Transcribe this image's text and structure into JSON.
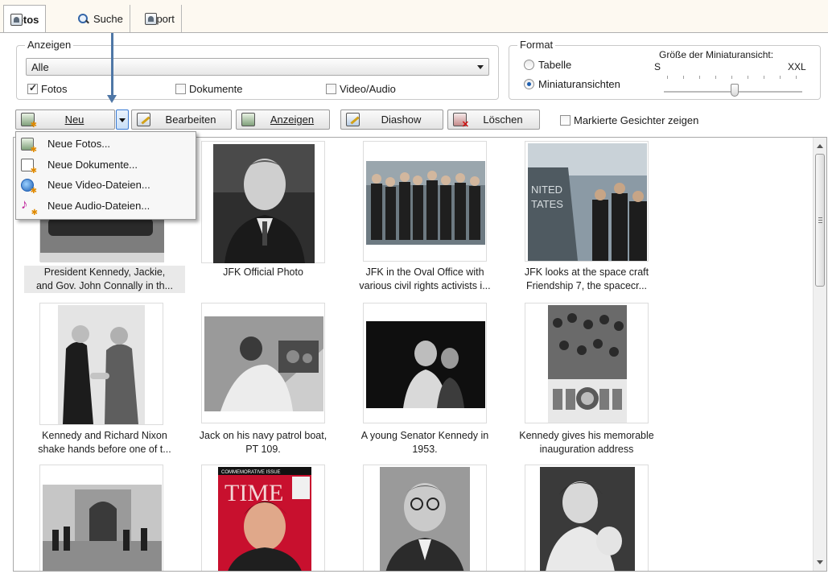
{
  "tabs": [
    {
      "label": "Fotos",
      "icon": "photos-icon"
    },
    {
      "label": "Suche",
      "icon": "search-icon"
    },
    {
      "label": "Import",
      "icon": "import-icon"
    }
  ],
  "display_group": {
    "legend": "Anzeigen",
    "select_value": "Alle",
    "checks": [
      {
        "label": "Fotos",
        "checked": true
      },
      {
        "label": "Dokumente",
        "checked": false
      },
      {
        "label": "Video/Audio",
        "checked": false
      }
    ]
  },
  "format_group": {
    "legend": "Format",
    "options": [
      {
        "label": "Tabelle",
        "selected": false
      },
      {
        "label": "Miniaturansichten",
        "selected": true
      }
    ],
    "size_label": "Größe der Miniaturansicht:",
    "size_min": "S",
    "size_max": "XXL",
    "size_level": 0.52
  },
  "toolbar": {
    "new_label": "Neu",
    "edit_label": "Bearbeiten",
    "view_label": "Anzeigen",
    "slideshow_label": "Diashow",
    "delete_label": "Löschen",
    "faces_label": "Markierte Gesichter zeigen",
    "faces_checked": false
  },
  "new_menu": [
    {
      "label": "Neue Fotos...",
      "icon": "new-photos-icon"
    },
    {
      "label": "Neue Dokumente...",
      "icon": "new-document-icon"
    },
    {
      "label": "Neue Video-Dateien...",
      "icon": "new-video-icon"
    },
    {
      "label": "Neue Audio-Dateien...",
      "icon": "new-audio-icon"
    }
  ],
  "photos": [
    {
      "caption1": "President Kennedy, Jackie,",
      "caption2": "and Gov. John Connally in th..."
    },
    {
      "caption1": "JFK Official Photo",
      "caption2": ""
    },
    {
      "caption1": "JFK in the Oval Office with",
      "caption2": "various civil rights activists i..."
    },
    {
      "caption1": "JFK looks at the space craft",
      "caption2": "Friendship 7, the spacecr..."
    },
    {
      "caption1": "Kennedy and Richard Nixon",
      "caption2": "shake hands before one of t..."
    },
    {
      "caption1": "Jack on his navy patrol boat,",
      "caption2": "PT 109."
    },
    {
      "caption1": "A young Senator Kennedy in",
      "caption2": "1953."
    },
    {
      "caption1": "Kennedy gives his memorable",
      "caption2": "inauguration address"
    },
    {
      "caption1": "",
      "caption2": ""
    },
    {
      "caption1": "",
      "caption2": ""
    },
    {
      "caption1": "",
      "caption2": ""
    },
    {
      "caption1": "",
      "caption2": ""
    }
  ],
  "magazine": {
    "masthead": "TIME",
    "banner": "COMMEMORATIVE ISSUE"
  },
  "colors": {
    "accent": "#1f5fb0",
    "pointer": "#4f77a6",
    "selection": "#e9e9e9"
  }
}
